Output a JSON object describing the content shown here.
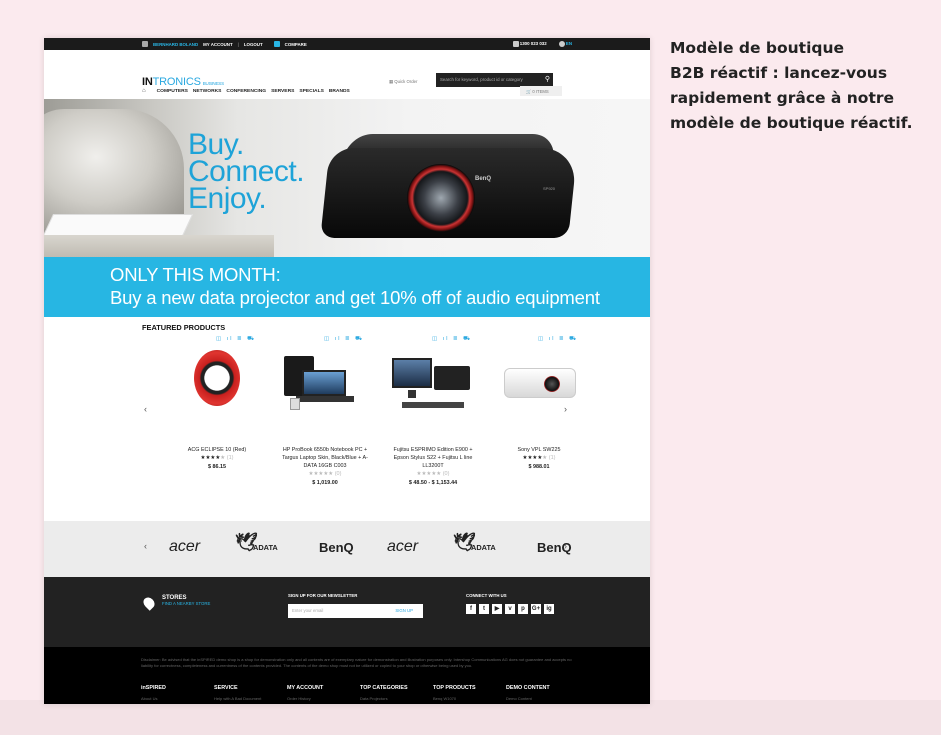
{
  "caption": {
    "lines": [
      "Modèle de boutique",
      "B2B réactif : lancez-vous",
      "rapidement grâce à notre",
      "modèle de boutique réactif."
    ]
  },
  "topbar": {
    "user": "BERNHARD BOLAND",
    "my_account": "MY ACCOUNT",
    "logout": "LOGOUT",
    "compare": "COMPARE",
    "phone": "1300 023 032",
    "language": "EN"
  },
  "header": {
    "logo_in": "IN",
    "logo_tronics": "TRONICS",
    "logo_sub": "BUSINESS",
    "quick_order": "Quick Order",
    "search_placeholder": "Search for keyword, product id or category",
    "cart_label": "0 ITEMS",
    "nav": [
      "COMPUTERS",
      "NETWORKS",
      "CONFERENCING",
      "SERVERS",
      "SPECIALS",
      "BRANDS"
    ]
  },
  "hero": {
    "tagline": [
      "Buy.",
      "Connect.",
      "Enjoy."
    ],
    "projector_brand": "BenQ",
    "projector_model": "SP920"
  },
  "promo": {
    "line1": "ONLY THIS MONTH:",
    "line2": "Buy a new data projector and get 10% off of audio equipment"
  },
  "featured": {
    "title": "FEATURED PRODUCTS",
    "products": [
      {
        "name": "ACG ECLIPSE 10 (Red)",
        "stars": "★★★★",
        "stars_empty": "★",
        "reviews": "(1)",
        "price": "$ 86.15"
      },
      {
        "name": "HP ProBook 6550b Notebook PC + Targus Laptop Skin, Black/Blue + A-DATA 16GB C003",
        "stars": "",
        "stars_empty": "★★★★★",
        "reviews": "(0)",
        "price": "$ 1,019.00"
      },
      {
        "name": "Fujitsu ESPRIMO Edition E900 + Epson Stylus S22 + Fujitsu L line LL3200T",
        "stars": "",
        "stars_empty": "★★★★★",
        "reviews": "(0)",
        "price": "$ 48.50 - $ 1,153.44"
      },
      {
        "name": "Sony VPL SW225",
        "stars": "★★★★",
        "stars_empty": "★",
        "reviews": "(1)",
        "price": "$ 988.01"
      }
    ]
  },
  "brands": [
    "acer",
    "ADATA",
    "BenQ",
    "acer",
    "ADATA",
    "BenQ"
  ],
  "footer": {
    "stores_title": "STORES",
    "stores_link": "FIND A NEARBY STORE",
    "newsletter_label": "SIGN UP FOR OUR NEWSLETTER",
    "newsletter_placeholder": "Enter your email",
    "newsletter_button": "SIGN UP",
    "connect_label": "CONNECT WITH US",
    "social": [
      "f",
      "t",
      "▶",
      "v",
      "p",
      "G+",
      "ig"
    ],
    "disclaimer": "Disclaimer: Be advised that the inSPIRED demo shop is a shop for demonstration only and all contents are of exemplary nature for demonstration and illustration purposes only. Intershop Communications AG does not guarantee and accepts no liability for correctness, completeness and currentness of the contents provided. The contents of the demo shop must not be utilized or copied to your shop or otherwise being used by you.",
    "columns": [
      {
        "title": "inSPIRED",
        "item": "About Us"
      },
      {
        "title": "SERVICE",
        "item": "Help with A Bad Document"
      },
      {
        "title": "MY ACCOUNT",
        "item": "Order History"
      },
      {
        "title": "TOP CATEGORIES",
        "item": "Data Projectors"
      },
      {
        "title": "TOP PRODUCTS",
        "item": "Benq W1070"
      },
      {
        "title": "DEMO CONTENT",
        "item": "Demo Content"
      }
    ]
  }
}
